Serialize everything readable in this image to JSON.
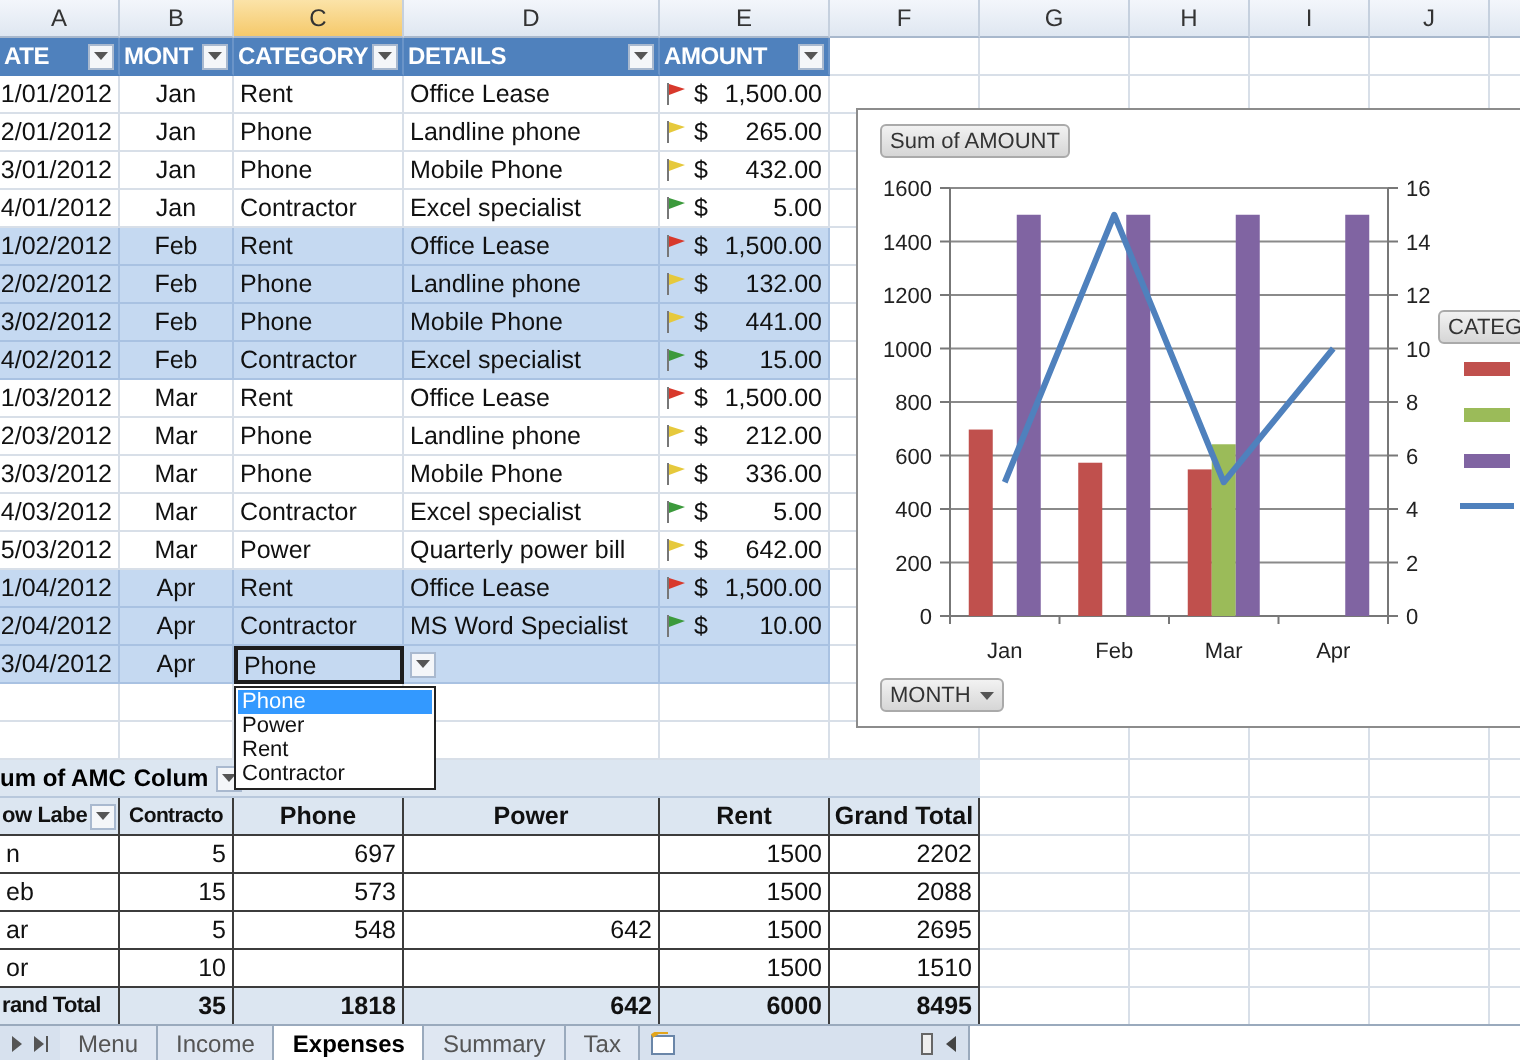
{
  "columns": [
    {
      "label": "A",
      "selected": false
    },
    {
      "label": "B",
      "selected": false
    },
    {
      "label": "C",
      "selected": true
    },
    {
      "label": "D",
      "selected": false
    },
    {
      "label": "E",
      "selected": false
    },
    {
      "label": "F",
      "selected": false
    },
    {
      "label": "G",
      "selected": false
    },
    {
      "label": "H",
      "selected": false
    },
    {
      "label": "I",
      "selected": false
    },
    {
      "label": "J",
      "selected": false
    }
  ],
  "table": {
    "headers": [
      "ATE",
      "MONT",
      "CATEGORY",
      "DETAILS",
      "AMOUNT"
    ],
    "rows": [
      {
        "date": "1/01/2012",
        "month": "Jan",
        "category": "Rent",
        "details": "Office Lease",
        "color": "#d8392c",
        "currency": "$",
        "amount": "1,500.00",
        "shaded": false,
        "editing": false
      },
      {
        "date": "2/01/2012",
        "month": "Jan",
        "category": "Phone",
        "details": "Landline phone",
        "color": "#e6c93c",
        "currency": "$",
        "amount": "265.00",
        "shaded": false,
        "editing": false
      },
      {
        "date": "3/01/2012",
        "month": "Jan",
        "category": "Phone",
        "details": "Mobile Phone",
        "color": "#e6c93c",
        "currency": "$",
        "amount": "432.00",
        "shaded": false,
        "editing": false
      },
      {
        "date": "4/01/2012",
        "month": "Jan",
        "category": "Contractor",
        "details": "Excel specialist",
        "color": "#3c9a3c",
        "currency": "$",
        "amount": "5.00",
        "shaded": false,
        "editing": false
      },
      {
        "date": "1/02/2012",
        "month": "Feb",
        "category": "Rent",
        "details": "Office Lease",
        "color": "#d8392c",
        "currency": "$",
        "amount": "1,500.00",
        "shaded": true,
        "editing": false
      },
      {
        "date": "2/02/2012",
        "month": "Feb",
        "category": "Phone",
        "details": "Landline phone",
        "color": "#e6c93c",
        "currency": "$",
        "amount": "132.00",
        "shaded": true,
        "editing": false
      },
      {
        "date": "3/02/2012",
        "month": "Feb",
        "category": "Phone",
        "details": "Mobile Phone",
        "color": "#e6c93c",
        "currency": "$",
        "amount": "441.00",
        "shaded": true,
        "editing": false
      },
      {
        "date": "4/02/2012",
        "month": "Feb",
        "category": "Contractor",
        "details": "Excel specialist",
        "color": "#3c9a3c",
        "currency": "$",
        "amount": "15.00",
        "shaded": true,
        "editing": false
      },
      {
        "date": "1/03/2012",
        "month": "Mar",
        "category": "Rent",
        "details": "Office Lease",
        "color": "#d8392c",
        "currency": "$",
        "amount": "1,500.00",
        "shaded": false,
        "editing": false
      },
      {
        "date": "2/03/2012",
        "month": "Mar",
        "category": "Phone",
        "details": "Landline phone",
        "color": "#e6c93c",
        "currency": "$",
        "amount": "212.00",
        "shaded": false,
        "editing": false
      },
      {
        "date": "3/03/2012",
        "month": "Mar",
        "category": "Phone",
        "details": "Mobile Phone",
        "color": "#e6c93c",
        "currency": "$",
        "amount": "336.00",
        "shaded": false,
        "editing": false
      },
      {
        "date": "4/03/2012",
        "month": "Mar",
        "category": "Contractor",
        "details": "Excel specialist",
        "color": "#3c9a3c",
        "currency": "$",
        "amount": "5.00",
        "shaded": false,
        "editing": false
      },
      {
        "date": "5/03/2012",
        "month": "Mar",
        "category": "Power",
        "details": "Quarterly power bill",
        "color": "#e6c93c",
        "currency": "$",
        "amount": "642.00",
        "shaded": false,
        "editing": false
      },
      {
        "date": "1/04/2012",
        "month": "Apr",
        "category": "Rent",
        "details": "Office Lease",
        "color": "#d8392c",
        "currency": "$",
        "amount": "1,500.00",
        "shaded": true,
        "editing": false
      },
      {
        "date": "2/04/2012",
        "month": "Apr",
        "category": "Contractor",
        "details": "MS Word Specialist",
        "color": "#3c9a3c",
        "currency": "$",
        "amount": "10.00",
        "shaded": true,
        "editing": false
      },
      {
        "date": "3/04/2012",
        "month": "Apr",
        "category": "Phone",
        "shaded": true,
        "editing": true
      }
    ],
    "dropdown_options": [
      {
        "label": "Phone",
        "selected": true
      },
      {
        "label": "Power",
        "selected": false
      },
      {
        "label": "Rent",
        "selected": false
      },
      {
        "label": "Contractor",
        "selected": false
      }
    ]
  },
  "chart": {
    "title_button": "Sum of AMOUNT",
    "axis_button": "MONTH",
    "legend_button": "CATEG",
    "chart_data": {
      "type": "bar",
      "categories": [
        "Jan",
        "Feb",
        "Mar",
        "Apr"
      ],
      "grid": true,
      "series": [
        {
          "color": "#c0504d",
          "values": [
            697,
            573,
            548,
            null
          ]
        },
        {
          "color": "#9bbb59",
          "values": [
            null,
            null,
            642,
            null
          ]
        },
        {
          "color": "#8064a2",
          "values": [
            1500,
            1500,
            1500,
            1500
          ]
        }
      ],
      "ylim": [
        0,
        1600
      ],
      "yticks": [
        0,
        200,
        400,
        600,
        800,
        1000,
        1200,
        1400,
        1600
      ]
    },
    "secondary": {
      "chart_data": {
        "type": "line",
        "series": [
          {
            "color": "#4f81bd",
            "values": [
              5,
              15,
              5,
              10
            ]
          }
        ],
        "ylim": [
          0,
          16
        ],
        "yticks": [
          0,
          2,
          4,
          6,
          8,
          10,
          12,
          14,
          16
        ]
      }
    }
  },
  "pivot": {
    "title": "um of AMC",
    "column_label": "Colum",
    "headers": [
      "ow Labe",
      "Contracto",
      "Phone",
      "Power",
      "Rent",
      "Grand Total"
    ],
    "rows": [
      {
        "label": "n",
        "cells": [
          "5",
          "697",
          null,
          "1500",
          "2202"
        ]
      },
      {
        "label": "eb",
        "cells": [
          "15",
          "573",
          null,
          "1500",
          "2088"
        ]
      },
      {
        "label": "ar",
        "cells": [
          "5",
          "548",
          "642",
          "1500",
          "2695"
        ]
      },
      {
        "label": "or",
        "cells": [
          "10",
          null,
          null,
          "1500",
          "1510"
        ]
      }
    ],
    "total": {
      "label": "rand Total",
      "cells": [
        "35",
        "1818",
        "642",
        "6000",
        "8495"
      ]
    }
  },
  "sheet_tabs": [
    {
      "label": "Menu",
      "selected": false
    },
    {
      "label": "Income",
      "selected": false
    },
    {
      "label": "Expenses",
      "selected": true
    },
    {
      "label": "Summary",
      "selected": false
    },
    {
      "label": "Tax",
      "selected": false
    }
  ]
}
